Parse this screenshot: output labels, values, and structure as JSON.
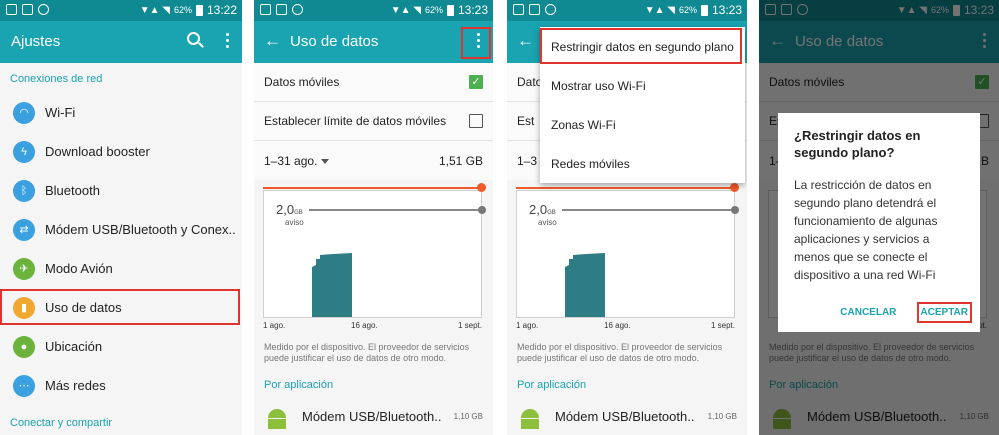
{
  "status": {
    "time1": "13:22",
    "time2": "13:23",
    "battery": "62%"
  },
  "colors": {
    "accent": "#1aa3b0",
    "highlight": "#e0342f",
    "bars": "#2e7d85",
    "limit": "#f05a28"
  },
  "screen1": {
    "title": "Ajustes",
    "section1": "Conexiones de red",
    "items": [
      {
        "label": "Wi-Fi",
        "icon": "wifi-icon",
        "color": "#3aa0e0"
      },
      {
        "label": "Download booster",
        "icon": "lightning-icon",
        "color": "#3aa0e0"
      },
      {
        "label": "Bluetooth",
        "icon": "bluetooth-icon",
        "color": "#3aa0e0"
      },
      {
        "label": "Módem USB/Bluetooth y Conex..",
        "icon": "tethering-icon",
        "color": "#3aa0e0"
      },
      {
        "label": "Modo Avión",
        "icon": "airplane-icon",
        "color": "#6cb33e"
      },
      {
        "label": "Uso de datos",
        "icon": "data-usage-icon",
        "color": "#f0a830"
      },
      {
        "label": "Ubicación",
        "icon": "location-icon",
        "color": "#6cb33e"
      },
      {
        "label": "Más redes",
        "icon": "more-networks-icon",
        "color": "#3aa0e0"
      }
    ],
    "section2": "Conectar y compartir"
  },
  "usage": {
    "title": "Uso de datos",
    "mobile_data": "Datos móviles",
    "limit_label": "Establecer límite de datos móviles",
    "limit_label_s3": "Est",
    "mobile_data_s3": "Dato",
    "cycle": "1–31 ago.",
    "cycle_s3": "1–3",
    "total": "1,51 GB",
    "warn_value": "2,0",
    "warn_unit": "GB",
    "warn_label": "aviso",
    "x_labels": [
      "1 ago.",
      "16 ago.",
      "1 sept."
    ],
    "note": "Medido por el dispositivo. El proveedor de servicios puede justificar el uso de datos de otro modo.",
    "by_app": "Por aplicación",
    "app_name": "Módem USB/Bluetooth..",
    "app_size": "1,10 GB"
  },
  "menu": [
    "Restringir datos en segundo plano",
    "Mostrar uso Wi-Fi",
    "Zonas Wi-Fi",
    "Redes móviles"
  ],
  "dialog": {
    "title": "¿Restringir datos en segundo plano?",
    "body": "La restricción de datos en segundo plano detendrá el funcionamiento de algunas aplicaciones y servicios a menos que se conecte el dispositivo a una red Wi-Fi",
    "cancel": "CANCELAR",
    "accept": "ACEPTAR"
  }
}
